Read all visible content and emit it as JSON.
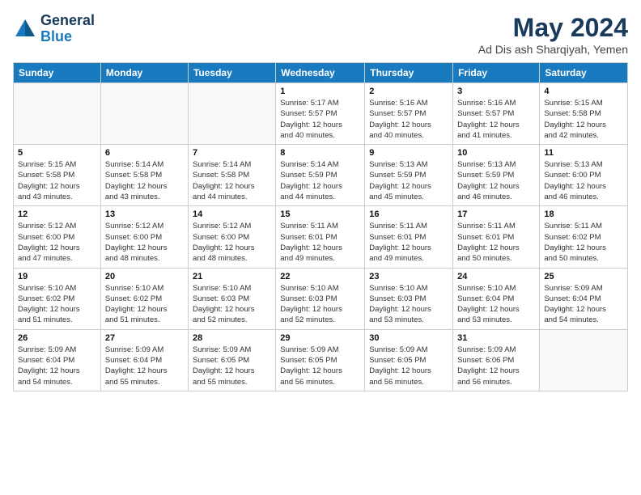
{
  "header": {
    "logo_general": "General",
    "logo_blue": "Blue",
    "month_year": "May 2024",
    "location": "Ad Dis ash Sharqiyah, Yemen"
  },
  "weekdays": [
    "Sunday",
    "Monday",
    "Tuesday",
    "Wednesday",
    "Thursday",
    "Friday",
    "Saturday"
  ],
  "weeks": [
    [
      {
        "day": "",
        "info": ""
      },
      {
        "day": "",
        "info": ""
      },
      {
        "day": "",
        "info": ""
      },
      {
        "day": "1",
        "info": "Sunrise: 5:17 AM\nSunset: 5:57 PM\nDaylight: 12 hours\nand 40 minutes."
      },
      {
        "day": "2",
        "info": "Sunrise: 5:16 AM\nSunset: 5:57 PM\nDaylight: 12 hours\nand 40 minutes."
      },
      {
        "day": "3",
        "info": "Sunrise: 5:16 AM\nSunset: 5:57 PM\nDaylight: 12 hours\nand 41 minutes."
      },
      {
        "day": "4",
        "info": "Sunrise: 5:15 AM\nSunset: 5:58 PM\nDaylight: 12 hours\nand 42 minutes."
      }
    ],
    [
      {
        "day": "5",
        "info": "Sunrise: 5:15 AM\nSunset: 5:58 PM\nDaylight: 12 hours\nand 43 minutes."
      },
      {
        "day": "6",
        "info": "Sunrise: 5:14 AM\nSunset: 5:58 PM\nDaylight: 12 hours\nand 43 minutes."
      },
      {
        "day": "7",
        "info": "Sunrise: 5:14 AM\nSunset: 5:58 PM\nDaylight: 12 hours\nand 44 minutes."
      },
      {
        "day": "8",
        "info": "Sunrise: 5:14 AM\nSunset: 5:59 PM\nDaylight: 12 hours\nand 44 minutes."
      },
      {
        "day": "9",
        "info": "Sunrise: 5:13 AM\nSunset: 5:59 PM\nDaylight: 12 hours\nand 45 minutes."
      },
      {
        "day": "10",
        "info": "Sunrise: 5:13 AM\nSunset: 5:59 PM\nDaylight: 12 hours\nand 46 minutes."
      },
      {
        "day": "11",
        "info": "Sunrise: 5:13 AM\nSunset: 6:00 PM\nDaylight: 12 hours\nand 46 minutes."
      }
    ],
    [
      {
        "day": "12",
        "info": "Sunrise: 5:12 AM\nSunset: 6:00 PM\nDaylight: 12 hours\nand 47 minutes."
      },
      {
        "day": "13",
        "info": "Sunrise: 5:12 AM\nSunset: 6:00 PM\nDaylight: 12 hours\nand 48 minutes."
      },
      {
        "day": "14",
        "info": "Sunrise: 5:12 AM\nSunset: 6:00 PM\nDaylight: 12 hours\nand 48 minutes."
      },
      {
        "day": "15",
        "info": "Sunrise: 5:11 AM\nSunset: 6:01 PM\nDaylight: 12 hours\nand 49 minutes."
      },
      {
        "day": "16",
        "info": "Sunrise: 5:11 AM\nSunset: 6:01 PM\nDaylight: 12 hours\nand 49 minutes."
      },
      {
        "day": "17",
        "info": "Sunrise: 5:11 AM\nSunset: 6:01 PM\nDaylight: 12 hours\nand 50 minutes."
      },
      {
        "day": "18",
        "info": "Sunrise: 5:11 AM\nSunset: 6:02 PM\nDaylight: 12 hours\nand 50 minutes."
      }
    ],
    [
      {
        "day": "19",
        "info": "Sunrise: 5:10 AM\nSunset: 6:02 PM\nDaylight: 12 hours\nand 51 minutes."
      },
      {
        "day": "20",
        "info": "Sunrise: 5:10 AM\nSunset: 6:02 PM\nDaylight: 12 hours\nand 51 minutes."
      },
      {
        "day": "21",
        "info": "Sunrise: 5:10 AM\nSunset: 6:03 PM\nDaylight: 12 hours\nand 52 minutes."
      },
      {
        "day": "22",
        "info": "Sunrise: 5:10 AM\nSunset: 6:03 PM\nDaylight: 12 hours\nand 52 minutes."
      },
      {
        "day": "23",
        "info": "Sunrise: 5:10 AM\nSunset: 6:03 PM\nDaylight: 12 hours\nand 53 minutes."
      },
      {
        "day": "24",
        "info": "Sunrise: 5:10 AM\nSunset: 6:04 PM\nDaylight: 12 hours\nand 53 minutes."
      },
      {
        "day": "25",
        "info": "Sunrise: 5:09 AM\nSunset: 6:04 PM\nDaylight: 12 hours\nand 54 minutes."
      }
    ],
    [
      {
        "day": "26",
        "info": "Sunrise: 5:09 AM\nSunset: 6:04 PM\nDaylight: 12 hours\nand 54 minutes."
      },
      {
        "day": "27",
        "info": "Sunrise: 5:09 AM\nSunset: 6:04 PM\nDaylight: 12 hours\nand 55 minutes."
      },
      {
        "day": "28",
        "info": "Sunrise: 5:09 AM\nSunset: 6:05 PM\nDaylight: 12 hours\nand 55 minutes."
      },
      {
        "day": "29",
        "info": "Sunrise: 5:09 AM\nSunset: 6:05 PM\nDaylight: 12 hours\nand 56 minutes."
      },
      {
        "day": "30",
        "info": "Sunrise: 5:09 AM\nSunset: 6:05 PM\nDaylight: 12 hours\nand 56 minutes."
      },
      {
        "day": "31",
        "info": "Sunrise: 5:09 AM\nSunset: 6:06 PM\nDaylight: 12 hours\nand 56 minutes."
      },
      {
        "day": "",
        "info": ""
      }
    ]
  ]
}
